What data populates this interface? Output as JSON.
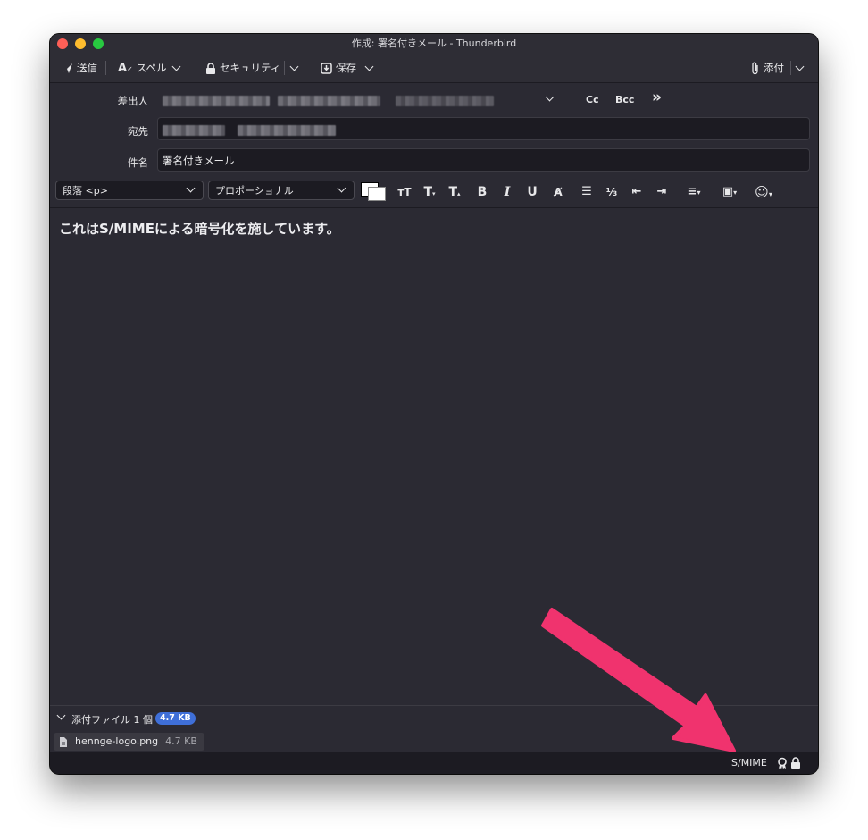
{
  "window": {
    "title": "作成: 署名付きメール - Thunderbird"
  },
  "toolbar": {
    "send_label": "送信",
    "spell_label": "スペル",
    "security_label": "セキュリティ",
    "save_label": "保存",
    "attach_label": "添付"
  },
  "header": {
    "from_label": "差出人",
    "to_label": "宛先",
    "subject_label": "件名",
    "subject_value": "署名付きメール",
    "cc_label": "Cc",
    "bcc_label": "Bcc"
  },
  "format": {
    "paragraph_value": "段落 <p>",
    "font_value": "プロポーショナル"
  },
  "body": {
    "text": "これはS/MIMEによる暗号化を施しています。"
  },
  "attachments": {
    "summary": "添付ファイル 1 個",
    "total_size": "4.7 KB",
    "items": [
      {
        "name": "hennge-logo.png",
        "size": "4.7 KB"
      }
    ]
  },
  "status": {
    "smime_label": "S/MIME"
  },
  "colors": {
    "annotation_arrow": "#f0336e",
    "badge": "#3f6fd8"
  }
}
